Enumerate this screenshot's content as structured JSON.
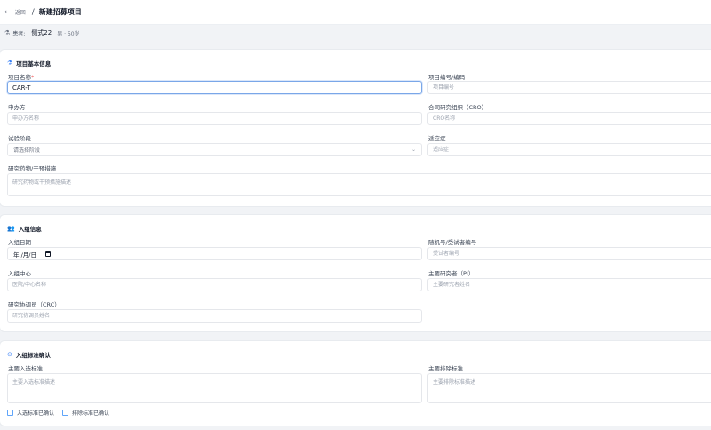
{
  "header": {
    "back_label": "返回",
    "separator": "/",
    "title": "新建招募项目"
  },
  "patient": {
    "label": "患者:",
    "name": "侧式22",
    "meta": "男 · 50岁"
  },
  "sections": {
    "basic": {
      "title": "项目基本信息",
      "name_label": "项目名称",
      "required_mark": "*",
      "name_value": "CAR-T",
      "code_label": "项目编号/编码",
      "code_placeholder": "项目编号",
      "sponsor_label": "申办方",
      "sponsor_placeholder": "申办方名称",
      "cro_label": "合同研究组织（CRO）",
      "cro_placeholder": "CRO名称",
      "phase_label": "试验阶段",
      "phase_placeholder": "请选择阶段",
      "indication_label": "适应症",
      "indication_placeholder": "适应症",
      "drug_label": "研究药物/干预措施",
      "drug_placeholder": "研究药物或干预措施描述"
    },
    "enrollment": {
      "title": "入组信息",
      "date_label": "入组日期",
      "date_value": "年 /月/日",
      "random_label": "随机号/受试者编号",
      "random_placeholder": "受试者编号",
      "center_label": "入组中心",
      "center_placeholder": "医院/中心名称",
      "pi_label": "主要研究者（PI）",
      "pi_placeholder": "主要研究者姓名",
      "crc_label": "研究协调员（CRC）",
      "crc_placeholder": "研究协调员姓名"
    },
    "criteria": {
      "title": "入组标准确认",
      "inclusion_label": "主要入选标准",
      "inclusion_placeholder": "主要入选标准描述",
      "exclusion_label": "主要排除标准",
      "exclusion_placeholder": "主要排除标准描述",
      "inclusion_check": "入选标准已确认",
      "exclusion_check": "排除标准已确认"
    }
  }
}
